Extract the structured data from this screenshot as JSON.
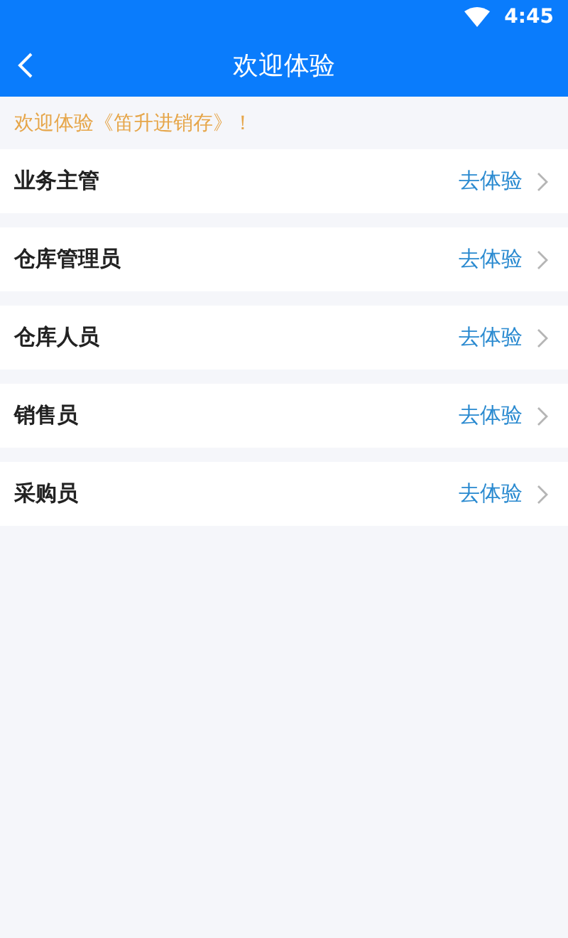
{
  "status_bar": {
    "time": "4:45"
  },
  "app_bar": {
    "title": "欢迎体验"
  },
  "notice": "欢迎体验《笛升进销存》！",
  "roles": [
    {
      "name": "业务主管",
      "action": "去体验"
    },
    {
      "name": "仓库管理员",
      "action": "去体验"
    },
    {
      "name": "仓库人员",
      "action": "去体验"
    },
    {
      "name": "销售员",
      "action": "去体验"
    },
    {
      "name": "采购员",
      "action": "去体验"
    }
  ]
}
